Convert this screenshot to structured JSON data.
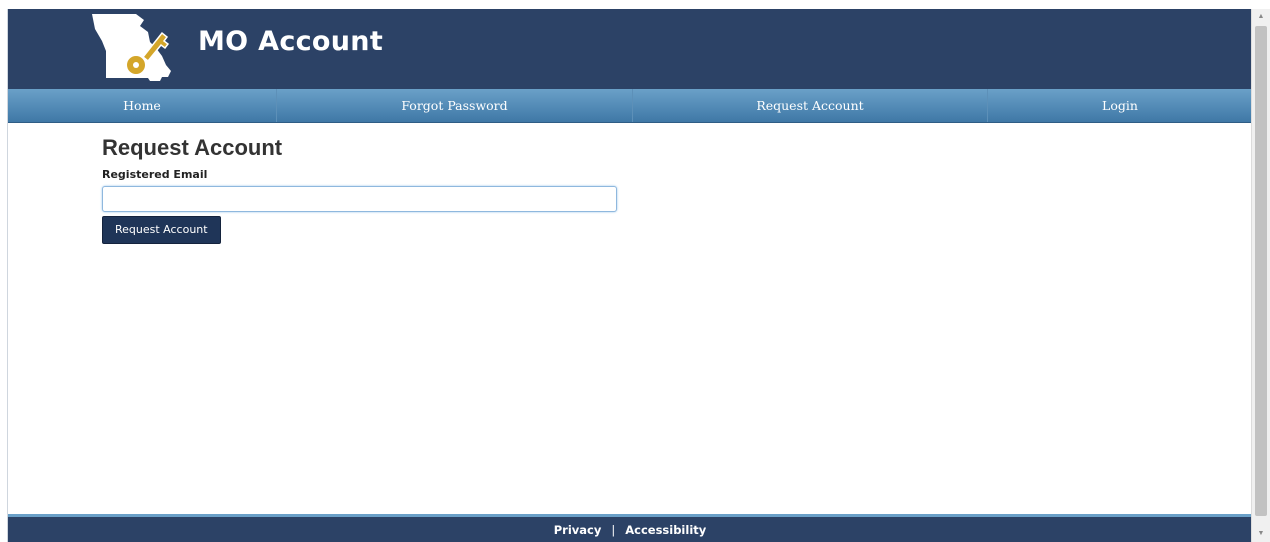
{
  "header": {
    "brand": "MO Account",
    "logo_icon": "missouri-state-key-icon",
    "colors": {
      "header_bg": "#2c4266",
      "key": "#d4a62a"
    }
  },
  "nav": {
    "items": [
      {
        "label": "Home"
      },
      {
        "label": "Forgot Password"
      },
      {
        "label": "Request Account"
      },
      {
        "label": "Login"
      }
    ]
  },
  "main": {
    "title": "Request Account",
    "email_label": "Registered Email",
    "email_value": "",
    "submit_label": "Request Account"
  },
  "footer": {
    "privacy": "Privacy",
    "separator": "|",
    "accessibility": "Accessibility"
  }
}
